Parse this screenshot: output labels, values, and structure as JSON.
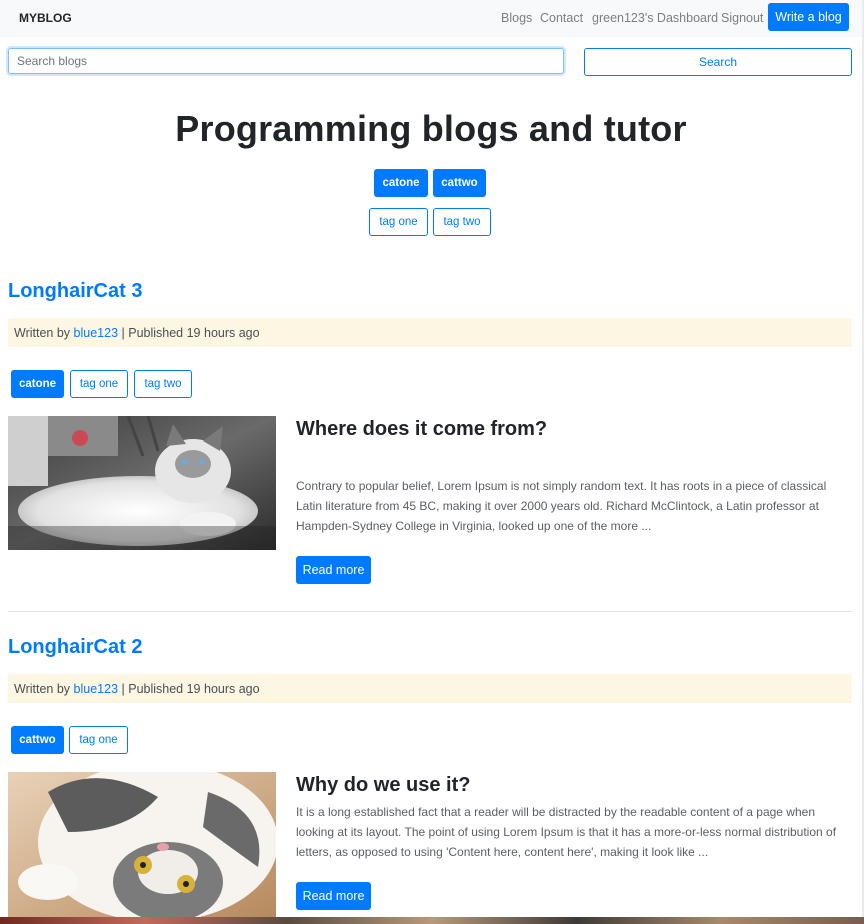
{
  "navbar": {
    "brand": "MYBLOG",
    "links": [
      "Blogs",
      "Contact",
      "green123's Dashboard",
      "Signout"
    ],
    "write_button": "Write a blog"
  },
  "search": {
    "placeholder": "Search blogs",
    "value": "",
    "button": "Search"
  },
  "heading": {
    "title": "Programming blogs and tutor",
    "categories": [
      "catone",
      "cattwo"
    ],
    "tags": [
      "tag one",
      "tag two"
    ]
  },
  "posts": [
    {
      "title": "LonghairCat 3",
      "written_by": "Written by",
      "author": "blue123",
      "published": "| Published 19 hours ago",
      "category": "catone",
      "tags": [
        "tag one",
        "tag two"
      ],
      "subtitle": "Where does it come from?",
      "excerpt": "Contrary to popular belief, Lorem Ipsum is not simply random text. It has roots in a piece of classical Latin literature from 45 BC, making it over 2000 years old. Richard McClintock, a Latin professor at Hampden-Sydney College in Virginia, looked up one of the more ...",
      "read_more": "Read more"
    },
    {
      "title": "LonghairCat 2",
      "written_by": "Written by",
      "author": "blue123",
      "published": "| Published 19 hours ago",
      "category": "cattwo",
      "tags": [
        "tag one"
      ],
      "subtitle": "Why do we use it?",
      "excerpt": "It is a long established fact that a reader will be distracted by the readable content of a page when looking at its layout. The point of using Lorem Ipsum is that it has a more-or-less normal distribution of letters, as opposed to using 'Content here, content here', making it look like ...",
      "read_more": "Read more"
    }
  ],
  "colors": {
    "primary": "#007bff",
    "meta_background": "#fcf6e3",
    "navbar_background": "#f8f9fa"
  }
}
